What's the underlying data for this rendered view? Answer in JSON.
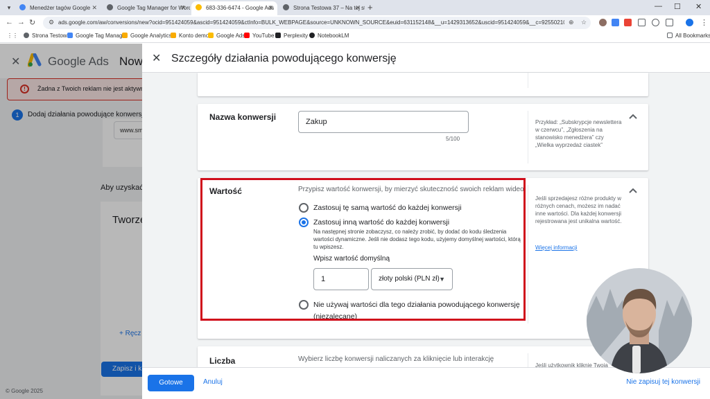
{
  "browser": {
    "tabs": [
      {
        "title": "Menedżer tagów Google",
        "active": false
      },
      {
        "title": "Google Tag Manager for WordP",
        "active": false
      },
      {
        "title": "683-336-6474 - Google Ads",
        "active": true
      },
      {
        "title": "Strona Testowa 37 – Na tej stro",
        "active": false
      }
    ],
    "url": "ads.google.com/aw/conversions/new?ocid=951424059&ascid=951424059&ctInfo=BULK_WEBPAGE&source=UNKNOWN_SOURCE&euid=631152148&__u=1429313652&uscid=951424059&__c=9255021091&authuser=0",
    "bookmarks": [
      "Strona Testowa",
      "Google Tag Manager",
      "Google Analytics",
      "Konto demo",
      "Google Ads",
      "YouTube",
      "Perplexity",
      "NotebookLM"
    ],
    "all_bookmarks": "All Bookmarks"
  },
  "background": {
    "brand": "Google Ads",
    "page_title": "Nowe",
    "alert_text": "Żadna z Twoich reklam nie jest aktywna",
    "step_number": "1",
    "step_text": "Dodaj działania powodujące konwersje",
    "url_value": "www.sm",
    "section_text": "Aby uzyskać",
    "card_title": "Tworze",
    "add_manual": "+ Ręcz",
    "save_button": "Zapisz i k",
    "copyright": "© Google 2025"
  },
  "panel": {
    "title": "Szczegóły działania powodującego konwersję",
    "name_section": {
      "label": "Nazwa konwersji",
      "value": "Zakup",
      "counter": "5/100",
      "help": "Przykład: „Subskrypcje newslettera w czerwcu”, „Zgłoszenia na stanowisko menedżera” czy „Wielka wyprzedaż ciastek”"
    },
    "value_section": {
      "label": "Wartość",
      "intro": "Przypisz wartość konwersji, by mierzyć skuteczność swoich reklam wideo",
      "options": [
        {
          "label": "Zastosuj tę samą wartość do każdej konwersji",
          "selected": false
        },
        {
          "label": "Zastosuj inną wartość do każdej konwersji",
          "selected": true,
          "description": "Na następnej stronie zobaczysz, co należy zrobić, by dodać do kodu śledzenia wartości dynamiczne. Jeśli nie dodasz tego kodu, użyjemy domyślnej wartości, którą tu wpiszesz."
        },
        {
          "label": "Nie używaj wartości dla tego działania powodującego konwersję",
          "sublabel": "(niezalecane)",
          "selected": false
        }
      ],
      "default_label": "Wpisz wartość domyślną",
      "default_value": "1",
      "currency": "złoty polski (PLN zł)",
      "help": "Jeśli sprzedajesz różne produkty w różnych cenach, możesz im nadać inne wartości. Dla każdej konwersji rejestrowana jest unikalna wartość.",
      "help_link": "Więcej informacji"
    },
    "count_section": {
      "label": "Liczba",
      "intro": "Wybierz liczbę konwersji naliczanych za kliknięcie lub interakcję",
      "help": "Jeśli użytkownik kliknie Twoją"
    },
    "footer": {
      "done": "Gotowe",
      "cancel": "Anuluj",
      "no_save": "Nie zapisuj tej konwersji"
    }
  },
  "colors": {
    "accent": "#1a73e8",
    "highlight": "#d00d1b",
    "alert": "#d93025"
  }
}
